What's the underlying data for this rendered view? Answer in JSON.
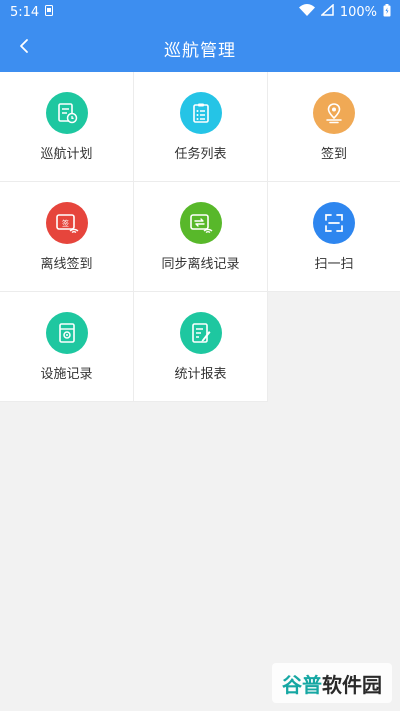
{
  "status_bar": {
    "time": "5:14",
    "battery": "100%"
  },
  "header": {
    "title": "巡航管理",
    "back_icon": "chevron-left-icon"
  },
  "colors": {
    "primary": "#3d8ef0",
    "teal": "#1ec7a0",
    "cyan": "#25c4e6",
    "orange": "#f0a955",
    "red": "#e6453c",
    "green": "#58b82a",
    "blue": "#2e86ef"
  },
  "grid": {
    "items": [
      {
        "label": "巡航计划",
        "icon": "patrol-plan-icon"
      },
      {
        "label": "任务列表",
        "icon": "task-list-icon"
      },
      {
        "label": "签到",
        "icon": "location-checkin-icon"
      },
      {
        "label": "离线签到",
        "icon": "offline-checkin-icon"
      },
      {
        "label": "同步离线记录",
        "icon": "sync-offline-icon"
      },
      {
        "label": "扫一扫",
        "icon": "scan-icon"
      },
      {
        "label": "设施记录",
        "icon": "facility-record-icon"
      },
      {
        "label": "统计报表",
        "icon": "statistics-report-icon"
      }
    ]
  },
  "watermark": {
    "part1": "谷普",
    "part2": "软件园"
  }
}
